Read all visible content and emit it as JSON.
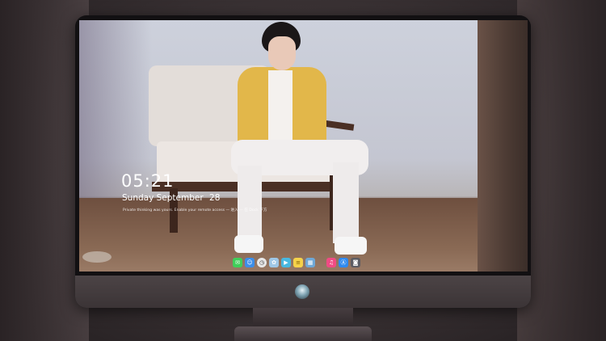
{
  "lock_screen": {
    "time": "05:21",
    "weekday_month": "Sunday September",
    "day": "28",
    "notice": "Private thinking was yours. Enable your remote access — 进入 — 在 Dock 下方"
  },
  "dock": {
    "icons": [
      {
        "name": "messages-icon",
        "color": "#3fcf5a"
      },
      {
        "name": "finder-icon",
        "color": "#3d8ee8"
      },
      {
        "name": "clock-icon",
        "color": "#e8e8e8"
      },
      {
        "name": "photos-icon",
        "color": "#9fc7e6"
      },
      {
        "name": "video-icon",
        "color": "#48b8e0"
      },
      {
        "name": "notes-icon",
        "color": "#f5d24a"
      },
      {
        "name": "preview-icon",
        "color": "#6fa8d6"
      },
      {
        "name": "music-icon",
        "color": "#f04b84"
      },
      {
        "name": "appstore-icon",
        "color": "#2f8af0"
      },
      {
        "name": "camera-icon",
        "color": "#5c5c62"
      }
    ]
  }
}
